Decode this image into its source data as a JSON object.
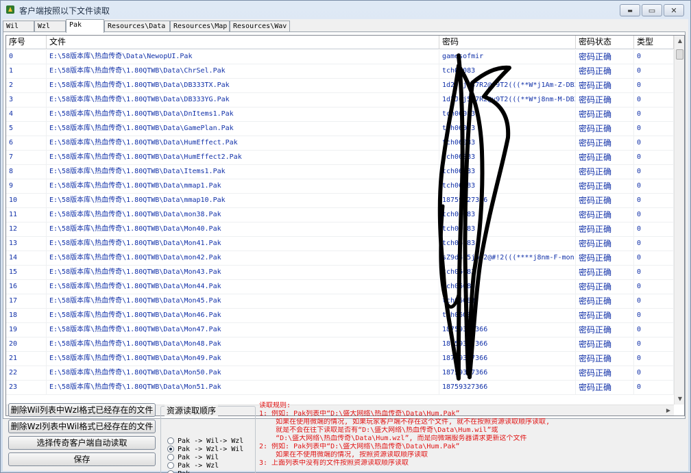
{
  "window": {
    "title": "客户端按照以下文件读取",
    "minimize_glyph": "▬",
    "maximize_glyph": "▭",
    "close_glyph": "✕"
  },
  "tabs": [
    "Wil",
    "Wzl",
    "Pak",
    "Resources\\Data",
    "Resources\\Map",
    "Resources\\Wav"
  ],
  "active_tab": "Pak",
  "table": {
    "columns": [
      "序号",
      "文件",
      "密码",
      "密码状态",
      "类型"
    ],
    "rows": [
      {
        "idx": "0",
        "file": "E:\\58版本库\\热血传奇\\Data\\NewopUI.Pak",
        "pwd": "gamesofmir",
        "status": "密码正确",
        "type": "0"
      },
      {
        "idx": "1",
        "file": "E:\\58版本库\\热血传奇\\1.80QTWB\\Data\\ChrSel.Pak",
        "pwd": "tch06083",
        "status": "密码正确",
        "type": "0"
      },
      {
        "idx": "2",
        "file": "E:\\58版本库\\热血传奇\\1.80QTWB\\Data\\DB333TX.Pak",
        "pwd": "1d2J6j547R2@y9T2(((**W*j1Am-Z-DB3",
        "status": "密码正确",
        "type": "0"
      },
      {
        "idx": "3",
        "file": "E:\\58版本库\\热血传奇\\1.80QTWB\\Data\\DB333YG.Pak",
        "pwd": "1d2J6j547R2@y9T2(((**W*j8nm-M-DB3",
        "status": "密码正确",
        "type": "0"
      },
      {
        "idx": "4",
        "file": "E:\\58版本库\\热血传奇\\1.80QTWB\\Data\\DnItems1.Pak",
        "pwd": "tch06083",
        "status": "密码正确",
        "type": "0"
      },
      {
        "idx": "5",
        "file": "E:\\58版本库\\热血传奇\\1.80QTWB\\Data\\GamePlan.Pak",
        "pwd": "tch06083",
        "status": "密码正确",
        "type": "0"
      },
      {
        "idx": "6",
        "file": "E:\\58版本库\\热血传奇\\1.80QTWB\\Data\\HumEffect.Pak",
        "pwd": "tch06083",
        "status": "密码正确",
        "type": "0"
      },
      {
        "idx": "7",
        "file": "E:\\58版本库\\热血传奇\\1.80QTWB\\Data\\HumEffect2.Pak",
        "pwd": "tch06083",
        "status": "密码正确",
        "type": "0"
      },
      {
        "idx": "8",
        "file": "E:\\58版本库\\热血传奇\\1.80QTWB\\Data\\Items1.Pak",
        "pwd": "tch06083",
        "status": "密码正确",
        "type": "0"
      },
      {
        "idx": "9",
        "file": "E:\\58版本库\\热血传奇\\1.80QTWB\\Data\\mmap1.Pak",
        "pwd": "tch06083",
        "status": "密码正确",
        "type": "0"
      },
      {
        "idx": "10",
        "file": "E:\\58版本库\\热血传奇\\1.80QTWB\\Data\\mmap10.Pak",
        "pwd": "18759327366",
        "status": "密码正确",
        "type": "0"
      },
      {
        "idx": "11",
        "file": "E:\\58版本库\\热血传奇\\1.80QTWB\\Data\\mon38.Pak",
        "pwd": "tch06083",
        "status": "密码正确",
        "type": "0"
      },
      {
        "idx": "12",
        "file": "E:\\58版本库\\热血传奇\\1.80QTWB\\Data\\Mon40.Pak",
        "pwd": "tch06083",
        "status": "密码正确",
        "type": "0"
      },
      {
        "idx": "13",
        "file": "E:\\58版本库\\热血传奇\\1.80QTWB\\Data\\Mon41.Pak",
        "pwd": "tch06083",
        "status": "密码正确",
        "type": "0"
      },
      {
        "idx": "14",
        "file": "E:\\58版本库\\热血传奇\\1.80QTWB\\Data\\mon42.Pak",
        "pwd": "sZ9d4j5j032@#!2(((****j8nm-F-mon",
        "status": "密码正确",
        "type": "0"
      },
      {
        "idx": "15",
        "file": "E:\\58版本库\\热血传奇\\1.80QTWB\\Data\\Mon43.Pak",
        "pwd": "tch06083",
        "status": "密码正确",
        "type": "0"
      },
      {
        "idx": "16",
        "file": "E:\\58版本库\\热血传奇\\1.80QTWB\\Data\\Mon44.Pak",
        "pwd": "tch06083",
        "status": "密码正确",
        "type": "0"
      },
      {
        "idx": "17",
        "file": "E:\\58版本库\\热血传奇\\1.80QTWB\\Data\\Mon45.Pak",
        "pwd": "tch06083",
        "status": "密码正确",
        "type": "0"
      },
      {
        "idx": "18",
        "file": "E:\\58版本库\\热血传奇\\1.80QTWB\\Data\\Mon46.Pak",
        "pwd": "tch06083",
        "status": "密码正确",
        "type": "0"
      },
      {
        "idx": "19",
        "file": "E:\\58版本库\\热血传奇\\1.80QTWB\\Data\\Mon47.Pak",
        "pwd": "18759327366",
        "status": "密码正确",
        "type": "0"
      },
      {
        "idx": "20",
        "file": "E:\\58版本库\\热血传奇\\1.80QTWB\\Data\\Mon48.Pak",
        "pwd": "18759327366",
        "status": "密码正确",
        "type": "0"
      },
      {
        "idx": "21",
        "file": "E:\\58版本库\\热血传奇\\1.80QTWB\\Data\\Mon49.Pak",
        "pwd": "18759327366",
        "status": "密码正确",
        "type": "0"
      },
      {
        "idx": "22",
        "file": "E:\\58版本库\\热血传奇\\1.80QTWB\\Data\\Mon50.Pak",
        "pwd": "18759327366",
        "status": "密码正确",
        "type": "0"
      },
      {
        "idx": "23",
        "file": "E:\\58版本库\\热血传奇\\1.80QTWB\\Data\\Mon51.Pak",
        "pwd": "18759327366",
        "status": "密码正确",
        "type": "0"
      }
    ]
  },
  "buttons": {
    "delete_wzl_from_wil": "删除Wil列表中Wzl格式已经存在的文件",
    "delete_wil_from_wzl": "删除Wzl列表中Wil格式已经存在的文件",
    "auto_read": "选择传奇客户端自动读取",
    "save": "保存"
  },
  "order": {
    "title": "资源读取顺序",
    "options": [
      "Pak -> Wil-> Wzl",
      "Pak -> Wzl-> Wil",
      "Pak -> Wil",
      "Pak -> Wzl",
      "Pak"
    ],
    "selected_index": 1
  },
  "rules": [
    "读取规则:",
    "1: 例如: Pak列表中“D:\\盛大网络\\热血传奇\\Data\\Hum.Pak”",
    "    如果在使用微端的情况, 如果玩家客户端不存在这个文件, 就不在按照资源读取顺序读取,",
    "    就是不会在往下读取是否有“D:\\盛大网络\\热血传奇\\Data\\Hum.wil”或",
    "    “D:\\盛大网络\\热血传奇\\Data\\Hum.wzl”, 而是向微端服务器请求更新这个文件",
    "2: 例如: Pak列表中“D:\\盛大网络\\热血传奇\\Data\\Hum.Pak”",
    "    如果在不使用微端的情况, 按照资源读取顺序读取",
    "3: 上面列表中没有的文件按照资源读取顺序读取"
  ],
  "colors": {
    "rules_text": "#e01414",
    "cell_text": "#1030a8",
    "scribble": "#000000"
  }
}
